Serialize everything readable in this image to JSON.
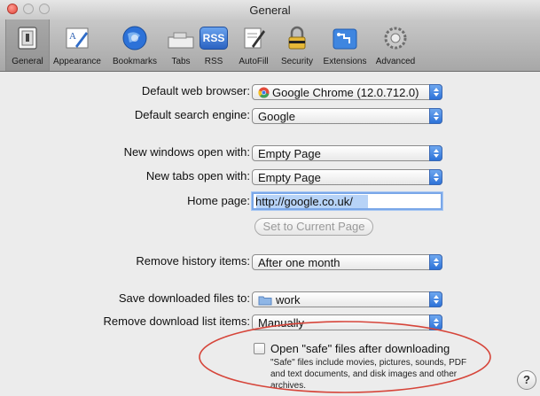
{
  "window": {
    "title": "General"
  },
  "toolbar": {
    "items": [
      {
        "label": "General",
        "icon": "general-icon",
        "selected": true
      },
      {
        "label": "Appearance",
        "icon": "appearance-icon"
      },
      {
        "label": "Bookmarks",
        "icon": "bookmarks-icon"
      },
      {
        "label": "Tabs",
        "icon": "tabs-icon"
      },
      {
        "label": "RSS",
        "icon": "rss-icon",
        "icon_text": "RSS"
      },
      {
        "label": "AutoFill",
        "icon": "autofill-icon"
      },
      {
        "label": "Security",
        "icon": "security-icon"
      },
      {
        "label": "Extensions",
        "icon": "extensions-icon"
      },
      {
        "label": "Advanced",
        "icon": "advanced-icon"
      }
    ]
  },
  "settings": {
    "default_browser": {
      "label": "Default web browser:",
      "value": "Google Chrome (12.0.712.0)"
    },
    "default_search": {
      "label": "Default search engine:",
      "value": "Google"
    },
    "new_windows": {
      "label": "New windows open with:",
      "value": "Empty Page"
    },
    "new_tabs": {
      "label": "New tabs open with:",
      "value": "Empty Page"
    },
    "home_page": {
      "label": "Home page:",
      "value": "http://google.co.uk/"
    },
    "set_current_button": "Set to Current Page",
    "remove_history": {
      "label": "Remove history items:",
      "value": "After one month"
    },
    "save_downloads": {
      "label": "Save downloaded files to:",
      "value": "work"
    },
    "remove_download_list": {
      "label": "Remove download list items:",
      "value": "Manually"
    },
    "open_safe": {
      "label": "Open \"safe\" files after downloading",
      "checked": false,
      "description": "\"Safe\" files include movies, pictures, sounds, PDF and text documents, and disk images and other archives."
    }
  },
  "help_button": "?",
  "colors": {
    "annotation_ellipse": "#d6453a",
    "popup_arrow": "#2d72d8"
  }
}
